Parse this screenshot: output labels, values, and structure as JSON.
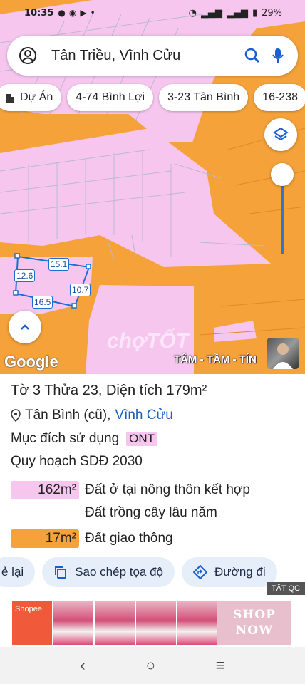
{
  "status_bar": {
    "time": "10:35",
    "battery": "29%"
  },
  "search": {
    "query": "Tân Triều, Vĩnh Cửu"
  },
  "chips": [
    {
      "label": "Dự Án"
    },
    {
      "label": "4-74 Bình Lợi"
    },
    {
      "label": "3-23 Tân Bình"
    },
    {
      "label": "16-238"
    }
  ],
  "parcel_dims": {
    "top": "15.1",
    "left": "12.6",
    "right": "10.7",
    "bottom": "16.5"
  },
  "map": {
    "attribution": "Google",
    "watermark": "chợTỐT",
    "shop_name": "TÂM - TẦM - TÍN",
    "colors": {
      "residential": "#f6c6ef",
      "traffic": "#f5a23a",
      "parcel_border": "#1a6fd1"
    }
  },
  "info": {
    "title": "Tờ 3 Thửa 23, Diện tích 179m²",
    "location_prefix": "Tân Bình (cũ),",
    "location_link": "Vĩnh Cửu",
    "purpose_label": "Mục đích sử dụng",
    "purpose_code": "ONT",
    "plan_label": "Quy hoạch SDĐ 2030",
    "areas": [
      {
        "value": "162m²",
        "label": "Đất ở tại nông thôn kết hợp",
        "color": "#f6c6ef"
      },
      {
        "value": "",
        "label": "Đất trồng cây lâu năm",
        "color": ""
      },
      {
        "value": "17m²",
        "label": "Đất giao thông",
        "color": "#f5a23a"
      }
    ]
  },
  "actions": [
    {
      "label": "ẻ lại",
      "icon": "share-icon"
    },
    {
      "label": "Sao chép tọa độ",
      "icon": "copy-icon"
    },
    {
      "label": "Đường đi",
      "icon": "directions-icon"
    }
  ],
  "ad": {
    "tag": "TẮT QC",
    "brand": "Shopee",
    "cta_line1": "SHOP",
    "cta_line2": "NOW"
  }
}
